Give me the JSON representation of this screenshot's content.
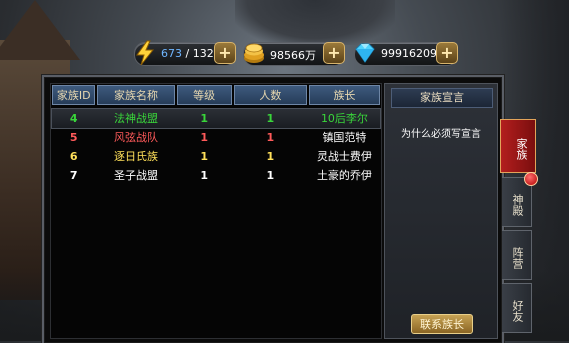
{
  "resources": {
    "energy": {
      "current": "673",
      "separator": " / ",
      "max": "132",
      "icon": "lightning-icon"
    },
    "gold": {
      "value": "98566万",
      "icon": "gold-coins-icon"
    },
    "diamond": {
      "value": "99916209",
      "icon": "diamond-icon"
    },
    "plus_label": "+"
  },
  "family_list": {
    "headers": [
      "家族ID",
      "家族名称",
      "等级",
      "人数",
      "族长"
    ],
    "rows": [
      {
        "id": "4",
        "name": "法神战盟",
        "level": "1",
        "members": "1",
        "leader": "10后李尔",
        "color": "#39d63a"
      },
      {
        "id": "5",
        "name": "风弦战队",
        "level": "1",
        "members": "1",
        "leader": "镇国范特",
        "color": "#ff5a5a"
      },
      {
        "id": "6",
        "name": "逐日氏族",
        "level": "1",
        "members": "1",
        "leader": "灵战士费伊",
        "color": "#ffe05a"
      },
      {
        "id": "7",
        "name": "圣子战盟",
        "level": "1",
        "members": "1",
        "leader": "土豪的乔伊",
        "color": "#ffffff"
      }
    ]
  },
  "declaration_panel": {
    "title": "家族宣言",
    "text": "为什么必须写宣言",
    "contact_button": "联系族长"
  },
  "side_tabs": [
    {
      "label": "家族",
      "active": true
    },
    {
      "label": "神殿",
      "active": false
    },
    {
      "label": "阵营",
      "active": false
    },
    {
      "label": "好友",
      "active": false
    }
  ]
}
